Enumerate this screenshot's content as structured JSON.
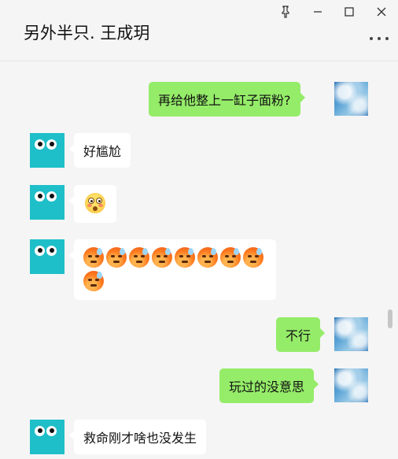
{
  "window": {
    "title": "另外半只. 王成玥",
    "controls": {
      "pin_icon": "pin-icon",
      "minimize_icon": "minimize-icon",
      "maximize_icon": "maximize-icon",
      "close_icon": "close-icon"
    },
    "more_icon": "more-dots-icon"
  },
  "messages": [
    {
      "side": "out",
      "text": "再给他整上一缸子面粉?"
    },
    {
      "side": "in",
      "text": "好尴尬"
    },
    {
      "side": "in",
      "emoji": "flushed-face",
      "count": 1
    },
    {
      "side": "in",
      "emoji": "anxious-sweat-face",
      "count": 9
    },
    {
      "side": "out",
      "text": "不行"
    },
    {
      "side": "out",
      "text": "玩过的没意思"
    },
    {
      "side": "in",
      "text": "救命刚才啥也没发生"
    }
  ],
  "colors": {
    "outgoing_bubble": "#95ec69",
    "incoming_bubble": "#ffffff",
    "background": "#f5f5f5",
    "avatar_contact": "#1ebfc9"
  }
}
